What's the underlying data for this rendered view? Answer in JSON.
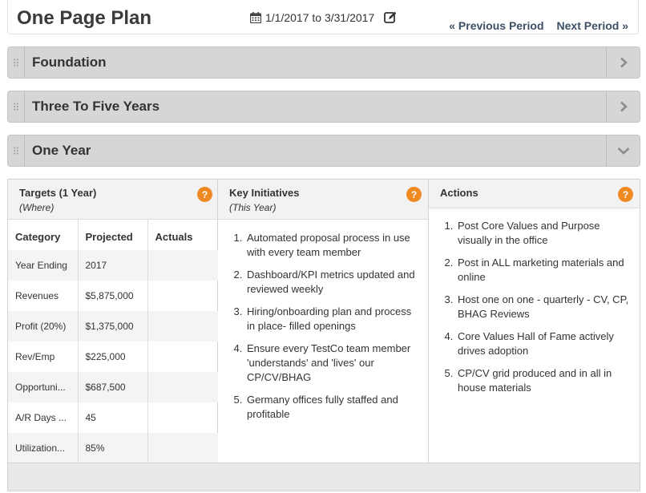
{
  "header": {
    "title": "One Page Plan",
    "period": "1/1/2017 to 3/31/2017",
    "prev_label": "« Previous Period",
    "next_label": "Next Period »"
  },
  "sections": [
    {
      "title": "Foundation",
      "state": "collapsed"
    },
    {
      "title": "Three To Five Years",
      "state": "collapsed"
    },
    {
      "title": "One Year",
      "state": "expanded"
    }
  ],
  "one_year": {
    "targets": {
      "title": "Targets (1 Year)",
      "subtitle": "(Where)",
      "columns": [
        "Category",
        "Projected",
        "Actuals"
      ],
      "rows": [
        [
          "Year Ending",
          "2017",
          ""
        ],
        [
          "Revenues",
          "$5,875,000",
          ""
        ],
        [
          "Profit (20%)",
          "$1,375,000",
          ""
        ],
        [
          "Rev/Emp",
          "$225,000",
          ""
        ],
        [
          "Opportuni...",
          "$687,500",
          ""
        ],
        [
          "A/R Days ...",
          "45",
          ""
        ],
        [
          "Utilization...",
          "85%",
          ""
        ]
      ]
    },
    "initiatives": {
      "title": "Key Initiatives",
      "subtitle": "(This Year)",
      "items": [
        "Automated proposal process in use with every team member",
        "Dashboard/KPI metrics updated and reviewed weekly",
        "Hiring/onboarding plan and process in place- filled openings",
        "Ensure every TestCo team member 'understands' and 'lives' our CP/CV/BHAG",
        "Germany offices fully staffed and profitable"
      ]
    },
    "actions": {
      "title": "Actions",
      "items": [
        "Post Core Values and Purpose visually in the office",
        "Post in ALL marketing materials and online",
        "Host one on one - quarterly - CV, CP, BHAG Reviews",
        "Core Values Hall of Fame actively drives adoption",
        "CP/CV grid produced and in all in house materials"
      ]
    },
    "help_glyph": "?"
  },
  "colors": {
    "help_badge": "#ef8a22",
    "section_bar": "#d6d6d6",
    "nav_link": "#3d4f66"
  }
}
